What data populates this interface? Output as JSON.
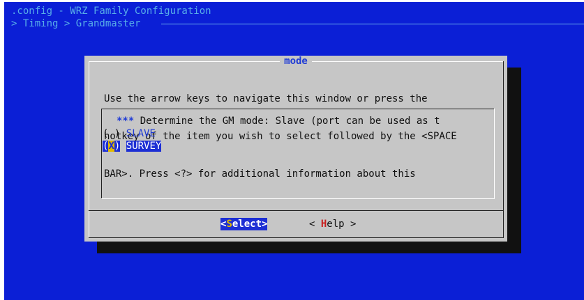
{
  "window": {
    "title": ".config - WRZ Family Configuration",
    "breadcrumb": "> Timing > Grandmaster"
  },
  "dialog": {
    "title": "mode",
    "help_lines": [
      "Use the arrow keys to navigate this window or press the",
      "hotkey of the item you wish to select followed by the <SPACE",
      "BAR>. Press <?> for additional information about this"
    ],
    "list": {
      "header_stars": "***",
      "header_text": " Determine the GM mode: Slave (port can be used as t",
      "items": [
        {
          "marker_open": "(",
          "marker_mark": " ",
          "marker_close": ")",
          "hotkey": "S",
          "rest": "LAVE",
          "selected": false
        },
        {
          "marker_open": "(",
          "marker_mark": "X",
          "marker_close": ")",
          "hotkey": "S",
          "rest": "URVEY",
          "selected": true
        }
      ]
    },
    "buttons": {
      "select": {
        "open": "<",
        "hotkey": "S",
        "rest": "elect",
        "close": ">"
      },
      "help": {
        "open": "< ",
        "hotkey": "H",
        "rest": "elp",
        "close": " >"
      }
    }
  },
  "colors": {
    "screen_bg": "#0b1fd6",
    "dialog_bg": "#c6c6c6",
    "title_text": "#58aee8",
    "highlight_bg": "#1d2fd4",
    "hotkey_yellow": "#e0b800",
    "hotkey_red": "#c81e1e"
  }
}
